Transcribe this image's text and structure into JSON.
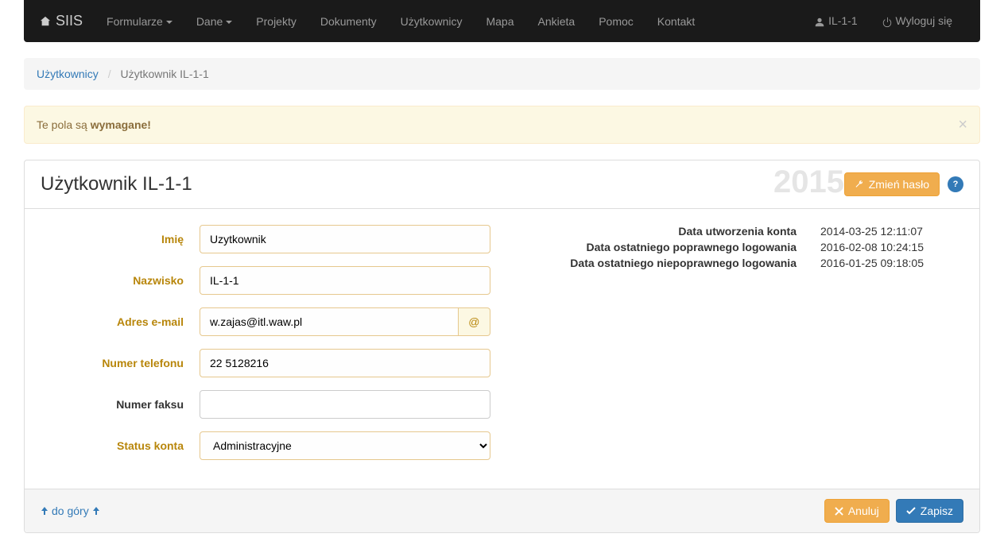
{
  "nav": {
    "brand": "SIIS",
    "items": [
      "Formularze",
      "Dane",
      "Projekty",
      "Dokumenty",
      "Użytkownicy",
      "Mapa",
      "Ankieta",
      "Pomoc",
      "Kontakt"
    ],
    "user": "IL-1-1",
    "logout": "Wyloguj się"
  },
  "breadcrumb": {
    "parent": "Użytkownicy",
    "current": "Użytkownik IL-1-1"
  },
  "alert": {
    "prefix": "Te pola są ",
    "strong": "wymagane!"
  },
  "panel": {
    "title": "Użytkownik IL-1-1",
    "year": "2015",
    "change_password": "Zmień hasło"
  },
  "form": {
    "labels": {
      "imie": "Imię",
      "nazwisko": "Nazwisko",
      "email": "Adres e-mail",
      "telefon": "Numer telefonu",
      "faks": "Numer faksu",
      "status": "Status konta"
    },
    "values": {
      "imie": "Uzytkownik",
      "nazwisko": "IL-1-1",
      "email": "w.zajas@itl.waw.pl",
      "telefon": "22 5128216",
      "faks": "",
      "status": "Administracyjne"
    },
    "email_addon": "@"
  },
  "info": {
    "rows": [
      {
        "label": "Data utworzenia konta",
        "value": "2014-03-25 12:11:07"
      },
      {
        "label": "Data ostatniego poprawnego logowania",
        "value": "2016-02-08 10:24:15"
      },
      {
        "label": "Data ostatniego niepoprawnego logowania",
        "value": "2016-01-25 09:18:05"
      }
    ]
  },
  "footer": {
    "to_top": "do góry",
    "cancel": "Anuluj",
    "save": "Zapisz"
  }
}
